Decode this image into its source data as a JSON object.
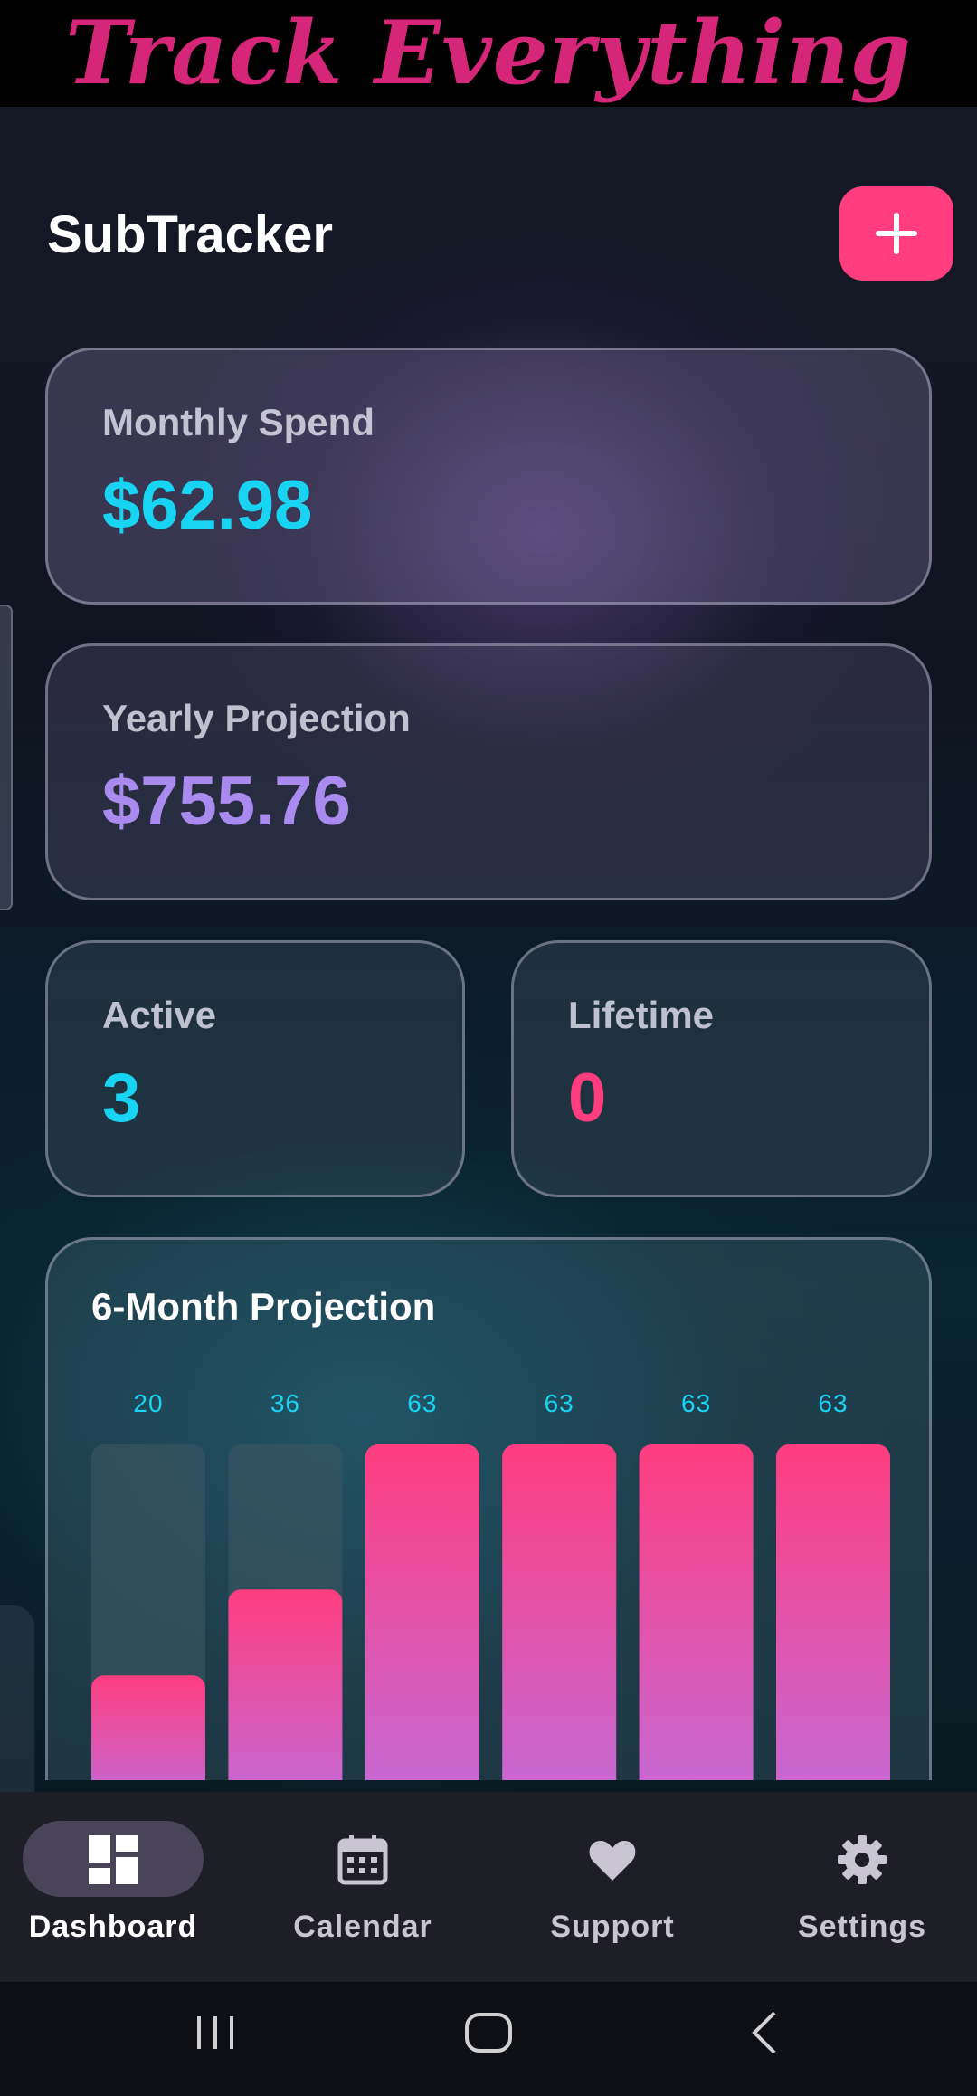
{
  "banner": {
    "text": "Track Everything"
  },
  "header": {
    "title": "SubTracker",
    "add_button_icon": "plus-icon"
  },
  "stats": {
    "monthly": {
      "label": "Monthly Spend",
      "value": "$62.98",
      "color": "#19d3f2"
    },
    "yearly": {
      "label": "Yearly Projection",
      "value": "$755.76",
      "color": "#a98bf0"
    },
    "active": {
      "label": "Active",
      "value": "3",
      "color": "#19d3f2"
    },
    "lifetime": {
      "label": "Lifetime",
      "value": "0",
      "color": "#ff3d7f"
    }
  },
  "projection": {
    "title": "6-Month Projection"
  },
  "chart_data": {
    "type": "bar",
    "categories": [
      "",
      "",
      "",
      "",
      "",
      ""
    ],
    "values": [
      20,
      36,
      63,
      63,
      63,
      63
    ],
    "value_labels": [
      "20",
      "36",
      "63",
      "63",
      "63",
      "63"
    ],
    "ylim": [
      0,
      63
    ],
    "colors": {
      "bar_top": "#ff3d7f",
      "bar_bottom": "#c46ad6",
      "track": "#3a5663",
      "label": "#19d3f2"
    }
  },
  "nav": {
    "items": [
      {
        "label": "Dashboard",
        "icon": "dashboard-icon",
        "active": true
      },
      {
        "label": "Calendar",
        "icon": "calendar-icon",
        "active": false
      },
      {
        "label": "Support",
        "icon": "heart-icon",
        "active": false
      },
      {
        "label": "Settings",
        "icon": "gear-icon",
        "active": false
      }
    ]
  },
  "system_bar": {
    "icons": [
      "recent-apps-icon",
      "home-icon",
      "back-icon"
    ]
  }
}
